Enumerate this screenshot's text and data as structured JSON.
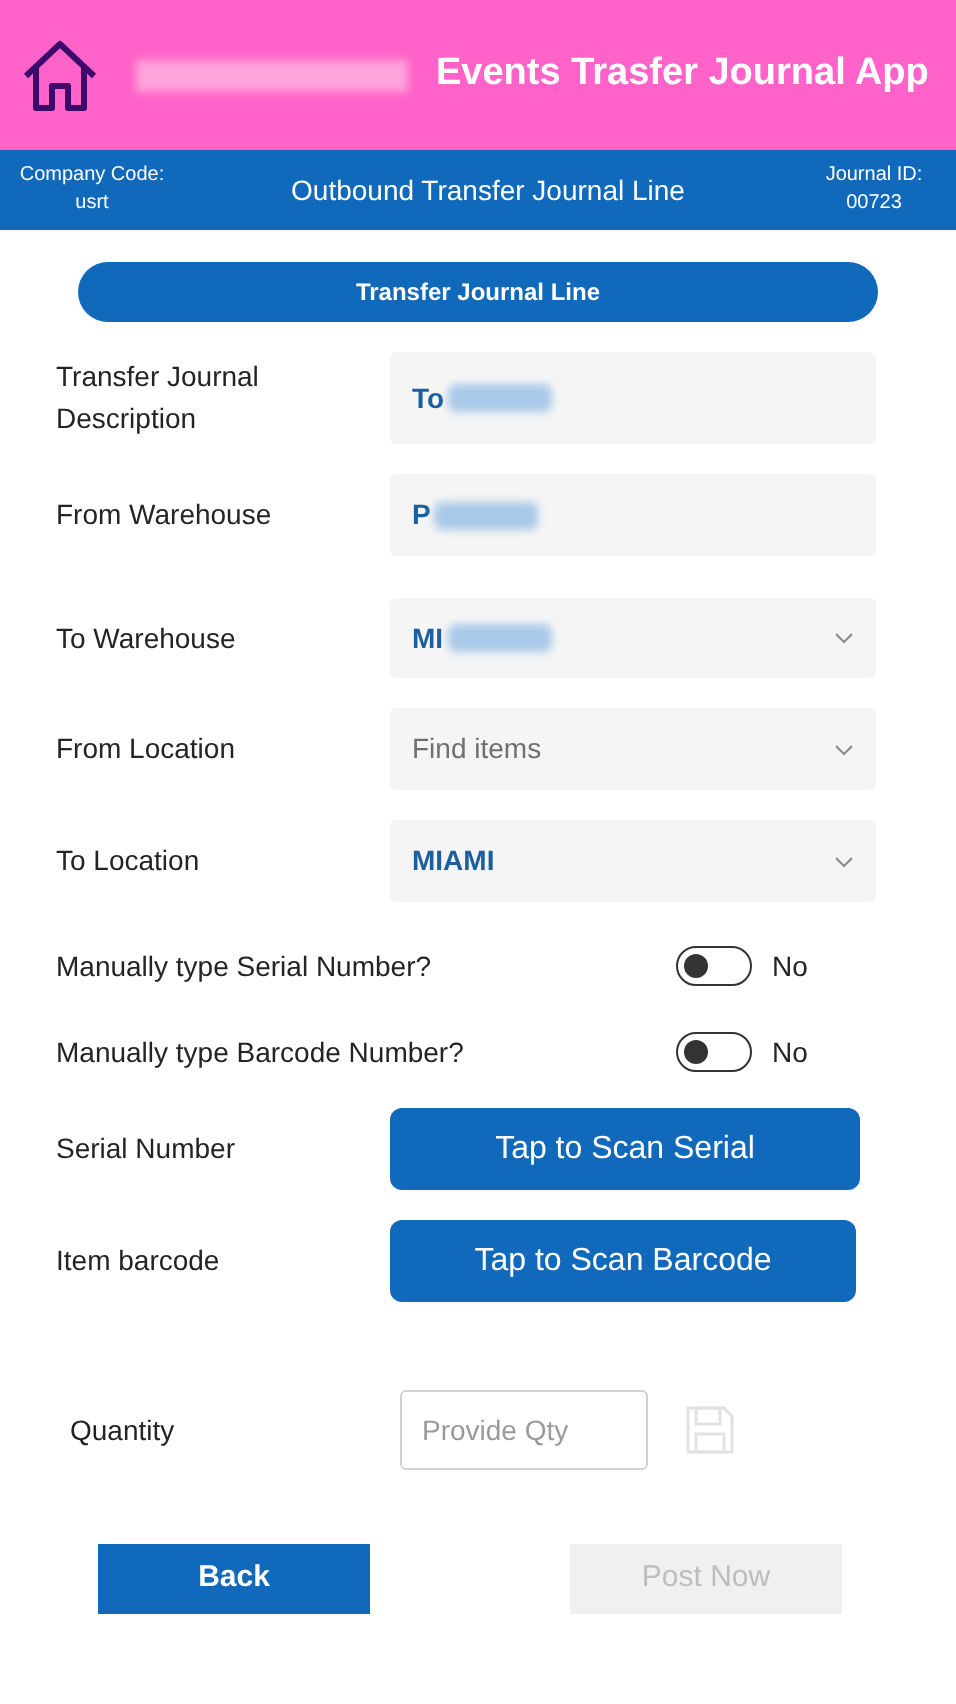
{
  "header": {
    "title": "Events Trasfer Journal App",
    "title_redacted": true
  },
  "subheader": {
    "company_label": "Company Code:",
    "company_code": "usrt",
    "title": "Outbound Transfer Journal Line",
    "journal_label": "Journal ID:",
    "journal_id": "00723"
  },
  "section_button": "Transfer Journal Line",
  "fields": [
    {
      "label": "Transfer Journal Description",
      "kind": "text",
      "value": "To",
      "redacted": true
    },
    {
      "label": "From Warehouse",
      "kind": "text",
      "value": "P",
      "redacted": true
    },
    {
      "label": "To Warehouse",
      "kind": "dropdown",
      "value": "MI",
      "redacted": true
    },
    {
      "label": "From Location",
      "kind": "dropdown",
      "placeholder": "Find items",
      "redacted": false
    },
    {
      "label": "To Location",
      "kind": "dropdown",
      "value": "MIAMI",
      "redacted": false
    }
  ],
  "toggles": [
    {
      "label": "Manually type Serial Number?",
      "on": false,
      "state_label": "No"
    },
    {
      "label": "Manually type Barcode Number?",
      "on": false,
      "state_label": "No"
    }
  ],
  "scans": [
    {
      "label": "Serial Number",
      "button": "Tap to Scan Serial"
    },
    {
      "label": "Item barcode",
      "button": "Tap to Scan Barcode"
    }
  ],
  "quantity": {
    "label": "Quantity",
    "placeholder": "Provide Qty"
  },
  "buttons": [
    {
      "label": "Back",
      "disabled": false
    },
    {
      "label": "Post Now",
      "disabled": true
    }
  ]
}
